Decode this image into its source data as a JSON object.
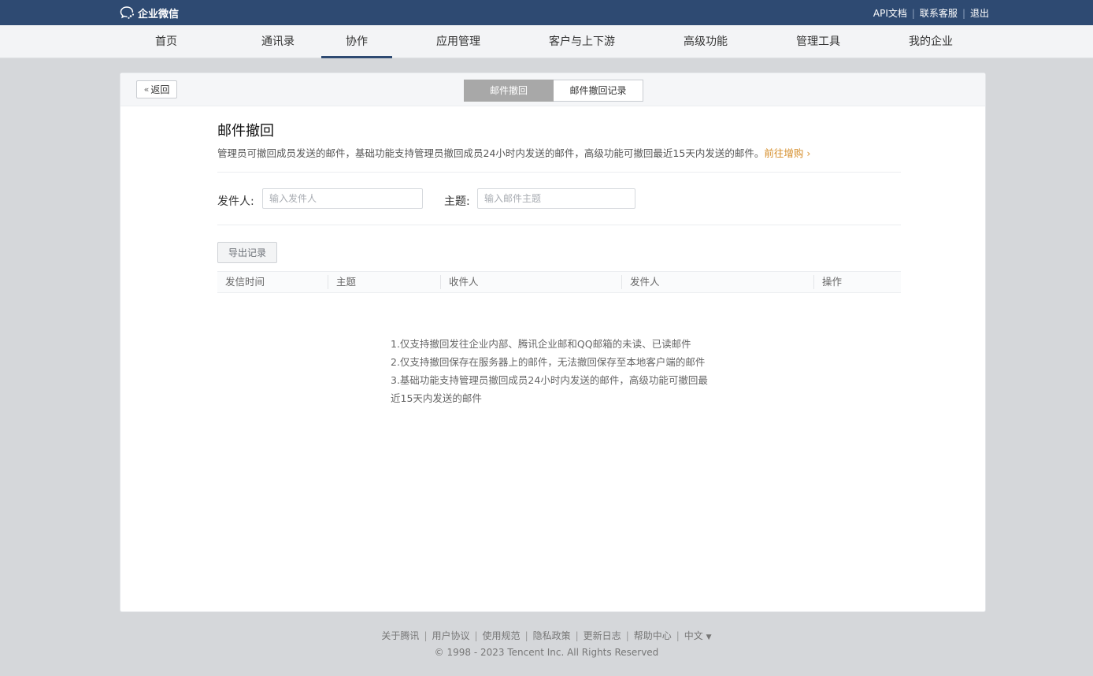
{
  "topbar": {
    "logo_text": "企业微信",
    "links": [
      "API文档",
      "联系客服",
      "退出"
    ]
  },
  "nav": {
    "items": [
      "首页",
      "通讯录",
      "协作",
      "应用管理",
      "客户与上下游",
      "高级功能",
      "管理工具",
      "我的企业"
    ],
    "active_index": 2
  },
  "card": {
    "back_label": "返回",
    "tabs": [
      "邮件撤回",
      "邮件撤回记录"
    ],
    "title": "邮件撤回",
    "description": "管理员可撤回成员发送的邮件，基础功能支持管理员撤回成员24小时内发送的邮件，高级功能可撤回最近15天内发送的邮件。",
    "upgrade_link": "前往增购",
    "filters": {
      "sender_label": "发件人:",
      "sender_placeholder": "输入发件人",
      "subject_label": "主题:",
      "subject_placeholder": "输入邮件主题"
    },
    "export_label": "导出记录",
    "table_headers": [
      "发信时间",
      "主题",
      "收件人",
      "发件人",
      "操作"
    ],
    "notice_lines": [
      "1.仅支持撤回发往企业内部、腾讯企业邮和QQ邮箱的未读、已读邮件",
      "2.仅支持撤回保存在服务器上的邮件，无法撤回保存至本地客户端的邮件",
      "3.基础功能支持管理员撤回成员24小时内发送的邮件，高级功能可撤回最",
      "近15天内发送的邮件"
    ]
  },
  "footer": {
    "links": [
      "关于腾讯",
      "用户协议",
      "使用规范",
      "隐私政策",
      "更新日志",
      "帮助中心",
      "中文"
    ],
    "copyright": "© 1998 - 2023 Tencent Inc. All Rights Reserved"
  },
  "colors": {
    "topbar": "#2e4a72",
    "accent_link": "#d58d2a",
    "active_tab": "#a8a8a8"
  }
}
